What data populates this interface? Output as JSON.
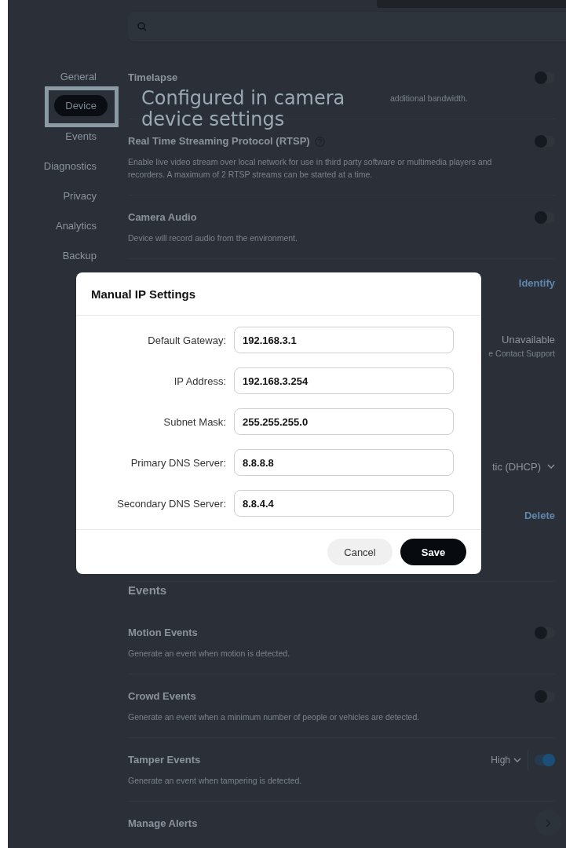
{
  "sidebar": {
    "items": [
      {
        "label": "General",
        "selected": false
      },
      {
        "label": "Device",
        "selected": true
      },
      {
        "label": "Events",
        "selected": false
      },
      {
        "label": "Diagnostics",
        "selected": false
      },
      {
        "label": "Privacy",
        "selected": false
      },
      {
        "label": "Analytics",
        "selected": false
      },
      {
        "label": "Backup",
        "selected": false
      }
    ]
  },
  "annotation": {
    "text": "Configured in camera device settings"
  },
  "settings": [
    {
      "kind": "toggle",
      "title": "Timelapse",
      "description": "additional bandwidth.",
      "on": false
    },
    {
      "kind": "toggle",
      "title": "Real Time Streaming Protocol (RTSP)",
      "help": true,
      "description": "Enable live video stream over local network for use in third party software or multimedia players and recorders. A maximum of 2 RTSP streams can be started at a time.",
      "on": false
    },
    {
      "kind": "toggle",
      "title": "Camera Audio",
      "description": "Device will record audio from the environment.",
      "on": false
    },
    {
      "kind": "action",
      "action": "Identify"
    },
    {
      "kind": "status",
      "status": "Unavailable",
      "note": "e Contact Support"
    },
    {
      "kind": "select",
      "value": "tic (DHCP)"
    },
    {
      "kind": "action",
      "action": "Delete"
    },
    {
      "kind": "heading",
      "title": "Events"
    },
    {
      "kind": "toggle",
      "title": "Motion Events",
      "description": "Generate an event when motion is detected.",
      "on": false
    },
    {
      "kind": "toggle",
      "title": "Crowd Events",
      "description": "Generate an event when a minimum number of people or vehicles are detected.",
      "on": false
    },
    {
      "kind": "toggle",
      "title": "Tamper Events",
      "description": "Generate an event when tampering is detected.",
      "level_select": "High",
      "on": true
    },
    {
      "kind": "link",
      "title": "Manage Alerts"
    }
  ],
  "dialog": {
    "title": "Manual IP Settings",
    "fields": [
      {
        "label": "Default Gateway:",
        "value": "192.168.3.1"
      },
      {
        "label": "IP Address:",
        "value": "192.168.3.254"
      },
      {
        "label": "Subnet Mask:",
        "value": "255.255.255.0"
      },
      {
        "label": "Primary DNS Server:",
        "value": "8.8.8.8"
      },
      {
        "label": "Secondary DNS Server:",
        "value": "8.8.4.4"
      }
    ],
    "buttons": [
      {
        "label": "Cancel",
        "kind": "secondary"
      },
      {
        "label": "Save",
        "kind": "primary"
      }
    ]
  }
}
